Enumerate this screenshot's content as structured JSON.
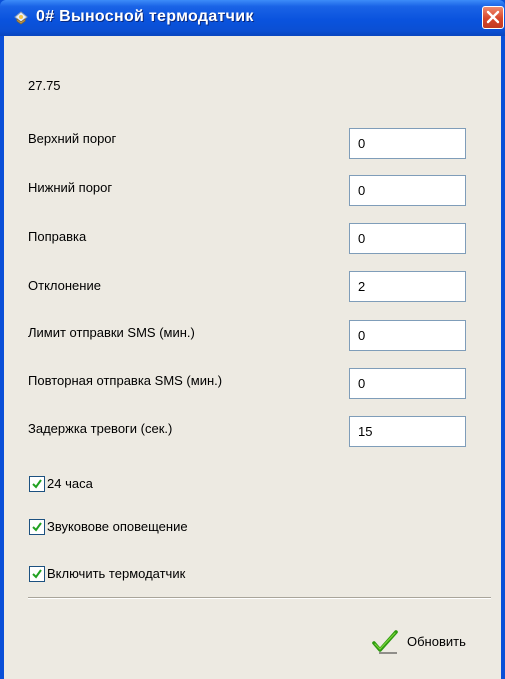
{
  "window": {
    "title": "0# Выносной термодатчик",
    "icon": "thermo-sensor-icon",
    "title_color": "#0a53de"
  },
  "reading": "27.75",
  "fields": [
    {
      "label": "Верхний порог",
      "value": "0"
    },
    {
      "label": "Нижний порог",
      "value": "0"
    },
    {
      "label": "Поправка",
      "value": "0"
    },
    {
      "label": "Отклонение",
      "value": "2"
    },
    {
      "label": "Лимит отправки SMS (мин.)",
      "value": "0"
    },
    {
      "label": "Повторная отправка SMS (мин.)",
      "value": "0"
    },
    {
      "label": "Задержка тревоги (сек.)",
      "value": "15"
    }
  ],
  "checkboxes": [
    {
      "label": "24 часа",
      "checked": true
    },
    {
      "label": "Звуковове оповещение",
      "checked": true
    },
    {
      "label": "Включить термодатчик",
      "checked": true
    }
  ],
  "refresh": {
    "label": "Обновить",
    "icon": "checkmark-icon",
    "accent": "#2e9a10"
  }
}
